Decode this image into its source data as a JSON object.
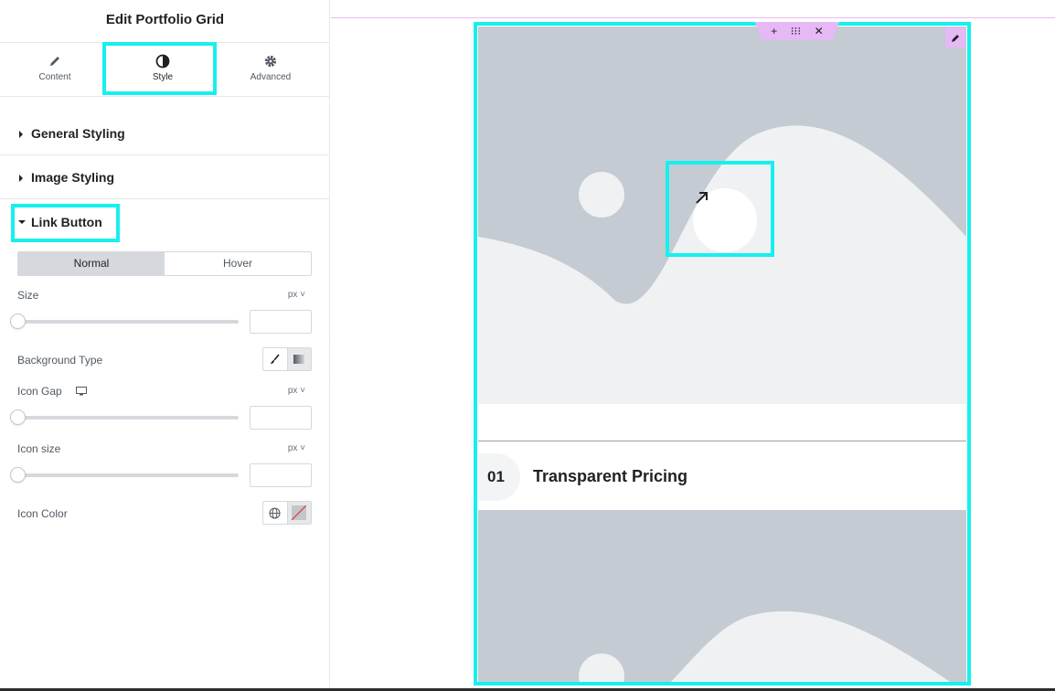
{
  "panel": {
    "title": "Edit Portfolio Grid",
    "tabs": [
      {
        "label": "Content",
        "icon": "pencil-icon"
      },
      {
        "label": "Style",
        "icon": "contrast-icon",
        "active": true
      },
      {
        "label": "Advanced",
        "icon": "gear-icon"
      }
    ],
    "sections": {
      "general": "General Styling",
      "image": "Image Styling",
      "link": "Link Button"
    },
    "state_toggle": {
      "normal": "Normal",
      "hover": "Hover",
      "selected": "Normal"
    },
    "controls": {
      "size": {
        "label": "Size",
        "unit": "px ˅",
        "value": ""
      },
      "bg_type": {
        "label": "Background Type"
      },
      "icon_gap": {
        "label": "Icon Gap",
        "unit": "px ˅",
        "value": ""
      },
      "icon_size": {
        "label": "Icon size",
        "unit": "px ˅",
        "value": ""
      },
      "icon_color": {
        "label": "Icon Color"
      }
    }
  },
  "canvas": {
    "item": {
      "number": "01",
      "title": "Transparent Pricing"
    },
    "handle_icons": [
      "plus-icon",
      "drag-icon",
      "close-icon"
    ]
  },
  "colors": {
    "highlight": "#16f0ee",
    "selection": "#e6b8f6",
    "placeholder": "#c4cbd2"
  }
}
